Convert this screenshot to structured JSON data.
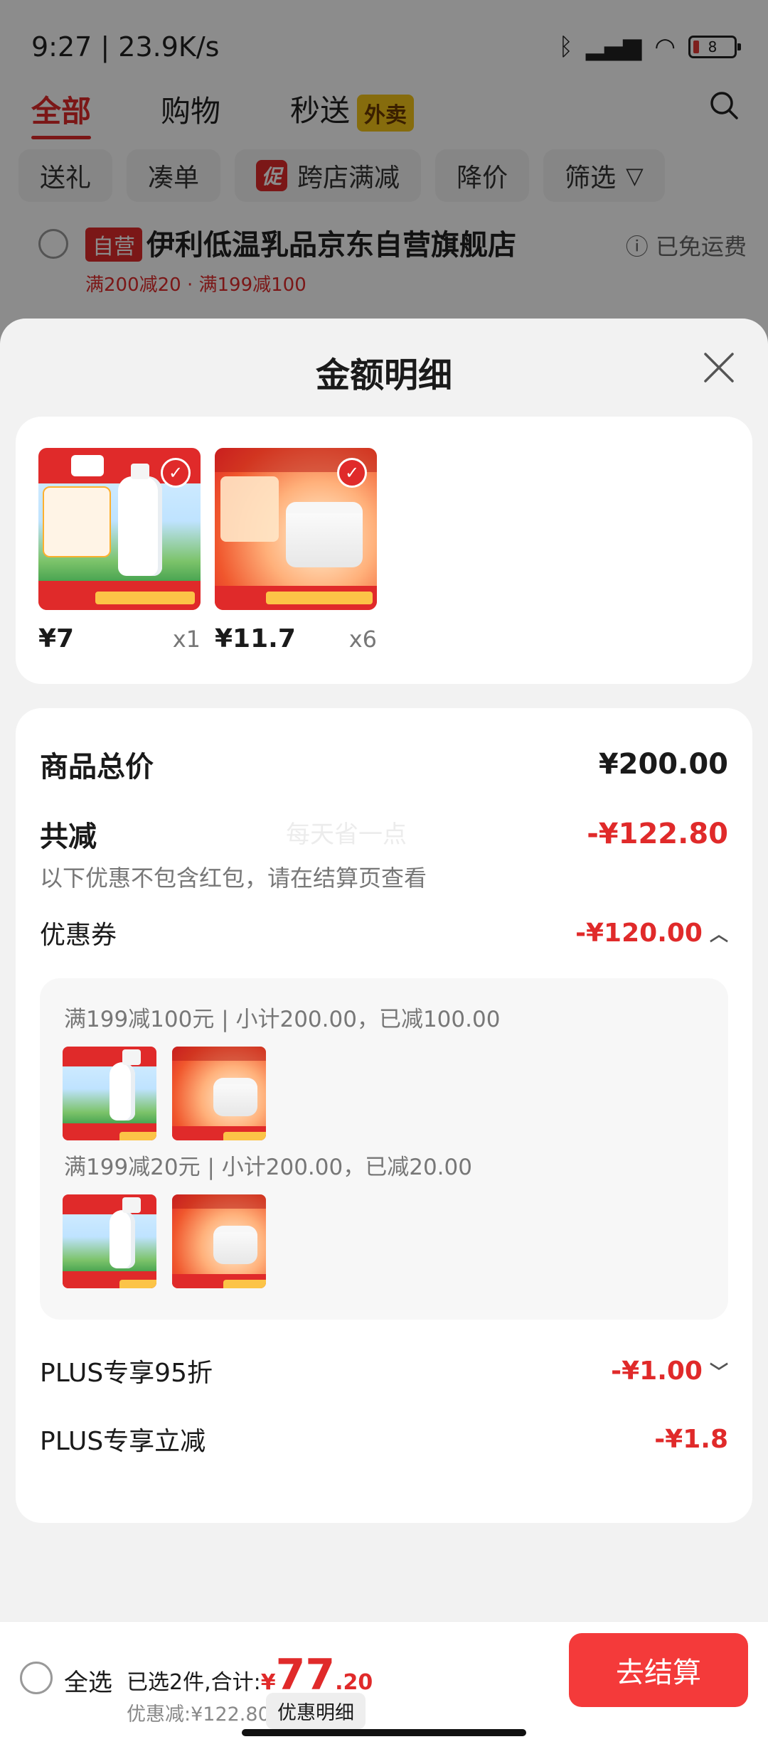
{
  "status_bar": {
    "time": "9:27 | 23.9K/s",
    "battery": "8"
  },
  "top_tabs": [
    {
      "label": "全部"
    },
    {
      "label": "购物"
    },
    {
      "label": "秒送",
      "badge": "外卖"
    }
  ],
  "filters": [
    {
      "label": "送礼"
    },
    {
      "label": "凑单"
    },
    {
      "label": "跨店满减",
      "tag": "促"
    },
    {
      "label": "降价"
    },
    {
      "label": "筛选"
    }
  ],
  "store": {
    "badge": "自营",
    "name": "伊利低温乳品京东自营旗舰店",
    "shipping": "已免运费",
    "promo": "满200减20 · 满199减100"
  },
  "sheet": {
    "title": "金额明细",
    "products": [
      {
        "price": "¥7",
        "qty": "x1"
      },
      {
        "price": "¥11.7",
        "qty": "x6"
      }
    ],
    "summary": {
      "total_label": "商品总价",
      "total_value": "¥200.00",
      "reduce_label": "共减",
      "reduce_value": "-¥122.80",
      "watermark": "每天省一点",
      "note": "以下优惠不包含红包，请在结算页查看",
      "coupon_label": "优惠券",
      "coupon_value": "-¥120.00",
      "coupons": [
        {
          "text": "满199减100元 | 小计200.00，已减100.00"
        },
        {
          "text": "满199减20元 | 小计200.00，已减20.00"
        }
      ],
      "plus95_label": "PLUS专享95折",
      "plus95_value": "-¥1.00",
      "plus_direct_label": "PLUS专享立减",
      "plus_direct_value": "-¥1.8"
    }
  },
  "bottom_bar": {
    "select_all": "全选",
    "selected_prefix": "已选2件,合计:",
    "yen": "¥",
    "total_int": "77",
    "total_dec": ".20",
    "discount": "优惠减:¥122.80",
    "detail_button": "优惠明细",
    "checkout": "去结算"
  },
  "colors": {
    "accent": "#e02a2a",
    "checkout": "#f43a3a"
  }
}
